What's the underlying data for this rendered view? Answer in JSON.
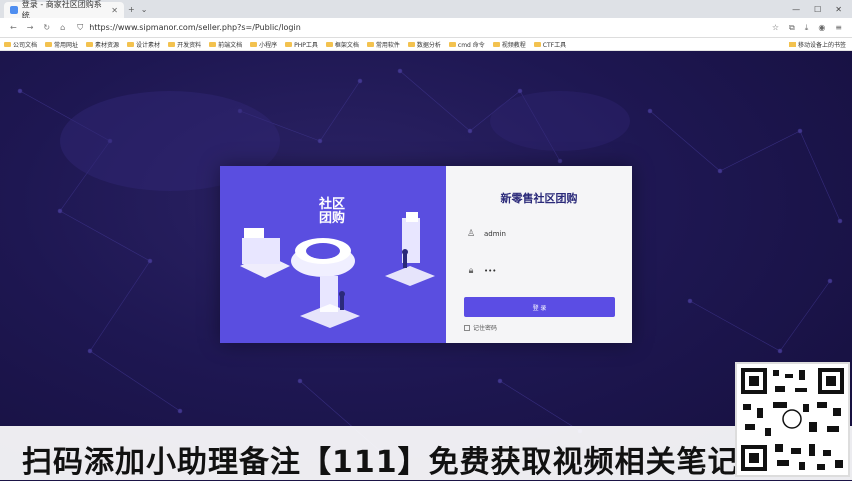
{
  "browser": {
    "tab_title": "登录 - 商家社区团购系统",
    "url": "https://www.sipmanor.com/seller.php?s=/Public/login",
    "bookmarks": [
      "公司文档",
      "常用网址",
      "素材资源",
      "设计素材",
      "开发资料",
      "前端文档",
      "小程序",
      "PHP工具",
      "框架文档",
      "常用软件",
      "数据分析",
      "cmd 命令",
      "视频教程",
      "CTF工具"
    ],
    "bookmarks_right": "移动设备上的书签"
  },
  "login": {
    "title": "新零售社区团购",
    "username_value": "admin",
    "password_value": "•••",
    "login_button": "登 录",
    "remember_label": "记住密码"
  },
  "illustration": {
    "sign_text": "社区团购"
  },
  "caption": {
    "text": "扫码添加小助理备注【111】免费获取视频相关笔记"
  },
  "colors": {
    "panel_purple": "#5a4ee0",
    "button_purple": "#5b4de4",
    "background": "#1e1752"
  }
}
